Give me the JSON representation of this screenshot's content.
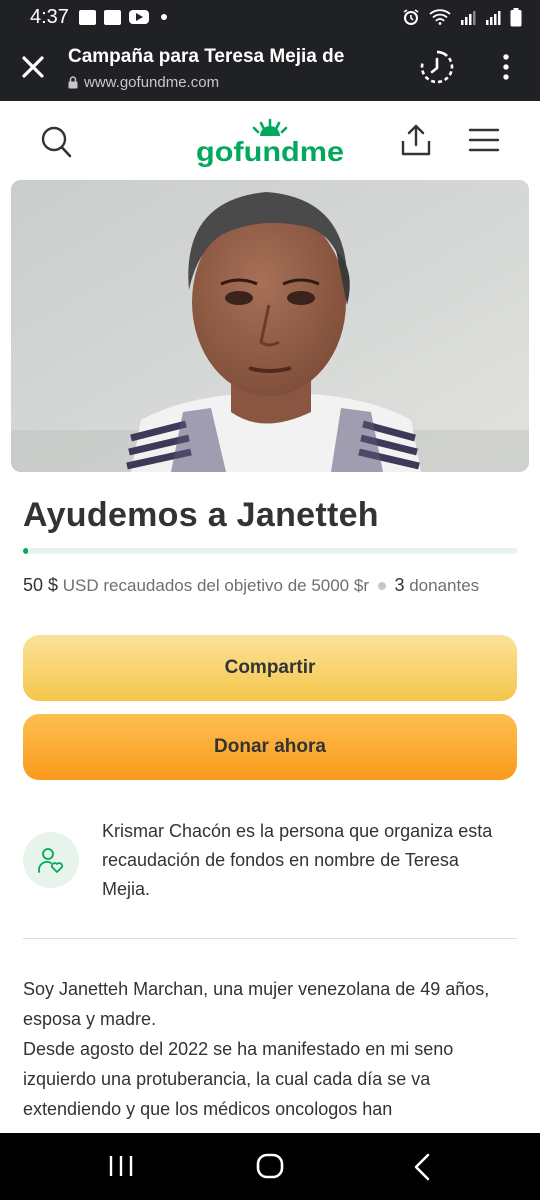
{
  "status_bar": {
    "time": "4:37",
    "left_icons": [
      "facebook-icon",
      "gallery-icon",
      "youtube-icon",
      "dot"
    ],
    "right_icons": [
      "alarm-icon",
      "wifi-icon",
      "signal-icon",
      "signal-icon",
      "battery-icon"
    ]
  },
  "browser": {
    "page_title": "Campaña para Teresa Mejia de",
    "url": "www.gofundme.com"
  },
  "site_header": {
    "logo_text": "gofundme",
    "logo_color": "#02a95c"
  },
  "campaign": {
    "title": "Ayudemos a Janetteh",
    "progress_fraction": 0.01,
    "raised_amount": "50 $",
    "raised_text": "USD recaudados del objetivo de 5000 $r",
    "donor_count": "3",
    "donor_label": "donantes"
  },
  "actions": {
    "share_label": "Compartir",
    "donate_label": "Donar ahora"
  },
  "organizer": {
    "text": "Krismar Chacón es la persona que organiza esta recaudación de fondos en nombre de Teresa Mejia."
  },
  "story": {
    "paragraph_1": "Soy Janetteh Marchan, una mujer venezolana de 49 años, esposa y madre.",
    "paragraph_2": "Desde agosto del 2022 se ha manifestado en mi seno izquierdo una protuberancia, la cual cada día se va extendiendo y que los médicos oncologos han"
  },
  "colors": {
    "brand_green": "#02a95c",
    "share_button": "#f8d26f",
    "donate_button": "#fbac36",
    "chrome_bg": "#202124"
  }
}
